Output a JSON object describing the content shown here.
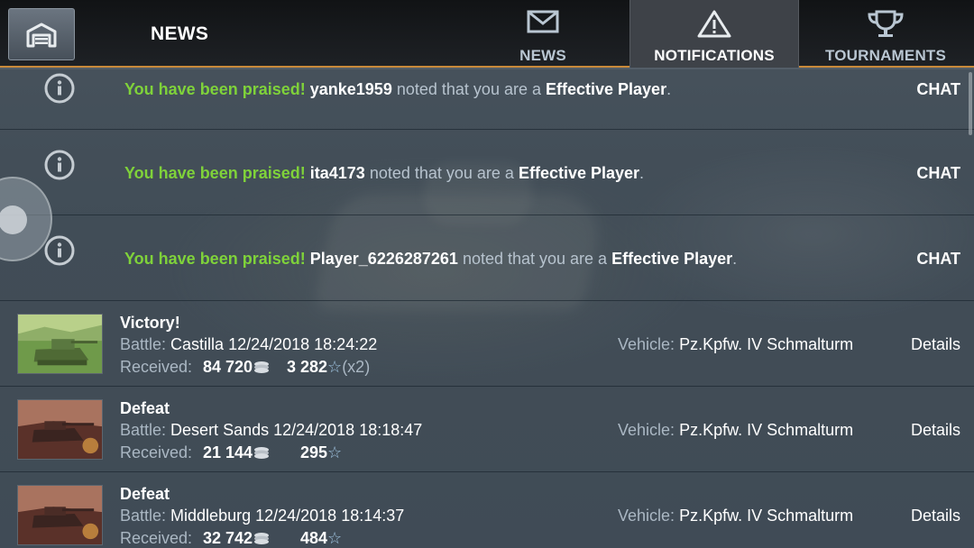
{
  "header": {
    "title": "NEWS",
    "tabs": [
      {
        "label": "NEWS",
        "icon": "envelope-icon",
        "active": false
      },
      {
        "label": "NOTIFICATIONS",
        "icon": "warning-triangle-icon",
        "active": true
      },
      {
        "label": "TOURNAMENTS",
        "icon": "trophy-icon",
        "active": false
      }
    ]
  },
  "notifications": [
    {
      "praised": "You have been praised!",
      "player": "yanke1959",
      "noted": "noted that you are a",
      "title": "Effective Player",
      "period": ".",
      "action": "CHAT"
    },
    {
      "praised": "You have been praised!",
      "player": "ita4173",
      "noted": "noted that you are a",
      "title": "Effective Player",
      "period": ".",
      "action": "CHAT"
    },
    {
      "praised": "You have been praised!",
      "player": "Player_6226287261",
      "noted": "noted that you are a",
      "title": "Effective Player",
      "period": ".",
      "action": "CHAT"
    }
  ],
  "battles": [
    {
      "result": "Victory!",
      "battle_label": "Battle:",
      "map": "Castilla 12/24/2018 18:24:22",
      "received_label": "Received:",
      "credits": "84 720",
      "xp": "3 282",
      "multiplier": "(x2)",
      "vehicle_label": "Vehicle:",
      "vehicle": "Pz.Kpfw. IV Schmalturm",
      "details": "Details"
    },
    {
      "result": "Defeat",
      "battle_label": "Battle:",
      "map": "Desert Sands 12/24/2018 18:18:47",
      "received_label": "Received:",
      "credits": "21 144",
      "xp": "295",
      "multiplier": "",
      "vehicle_label": "Vehicle:",
      "vehicle": "Pz.Kpfw. IV Schmalturm",
      "details": "Details"
    },
    {
      "result": "Defeat",
      "battle_label": "Battle:",
      "map": "Middleburg 12/24/2018 18:14:37",
      "received_label": "Received:",
      "credits": "32 742",
      "xp": "484",
      "multiplier": "",
      "vehicle_label": "Vehicle:",
      "vehicle": "Pz.Kpfw. IV Schmalturm",
      "details": "Details"
    }
  ],
  "colors": {
    "praised": "#7fd23a",
    "accent_border": "#c98a3a"
  }
}
